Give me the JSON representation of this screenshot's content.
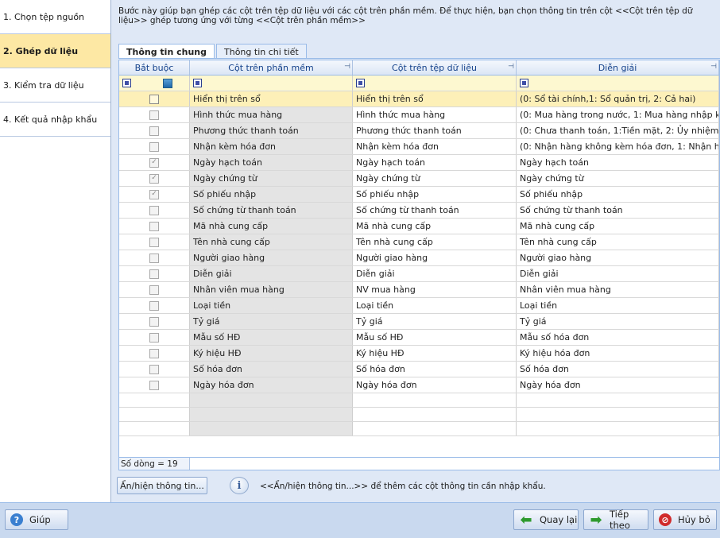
{
  "steps": [
    {
      "label": "1. Chọn tệp nguồn",
      "active": false
    },
    {
      "label": "2. Ghép dữ liệu",
      "active": true
    },
    {
      "label": "3. Kiểm tra dữ liệu",
      "active": false
    },
    {
      "label": "4. Kết quả nhập khẩu",
      "active": false
    }
  ],
  "description": "Bước này giúp bạn ghép các cột trên tệp dữ liệu với các cột trên phần mềm. Để thực hiện, bạn chọn thông tin trên cột <<Cột trên tệp dữ liệu>> ghép tương ứng với từng <<Cột trên phần mềm>>",
  "tabs": [
    {
      "label": "Thông tin chung",
      "active": true
    },
    {
      "label": "Thông tin chi tiết",
      "active": false
    }
  ],
  "grid": {
    "columns": [
      "Bắt buộc",
      "Cột trên phần mềm",
      "Cột trên tệp dữ liệu",
      "Diễn giải"
    ],
    "rows": [
      {
        "required": false,
        "software_col": "Hiển thị trên sổ",
        "file_col": "Hiển thị trên sổ",
        "note": "(0: Sổ tài chính,1: Sổ quản trị, 2: Cả hai)",
        "selected": true
      },
      {
        "required": false,
        "software_col": "Hình thức mua hàng",
        "file_col": "Hình thức mua hàng",
        "note": "(0: Mua hàng trong nước, 1: Mua hàng nhập khẩ..."
      },
      {
        "required": false,
        "software_col": "Phương thức thanh toán",
        "file_col": "Phương thức thanh toán",
        "note": "(0: Chưa thanh toán, 1:Tiền mặt, 2: Ủy nhiệm ch..."
      },
      {
        "required": false,
        "software_col": "Nhận kèm hóa đơn",
        "file_col": "Nhận kèm hóa đơn",
        "note": "(0: Nhận hàng không kèm hóa đơn, 1: Nhận hàn..."
      },
      {
        "required": true,
        "software_col": "Ngày hạch toán",
        "file_col": "Ngày hạch toán",
        "note": "Ngày hạch toán"
      },
      {
        "required": true,
        "software_col": "Ngày chứng từ",
        "file_col": "Ngày chứng từ",
        "note": "Ngày chứng từ"
      },
      {
        "required": true,
        "software_col": "Số phiếu nhập",
        "file_col": "Số phiếu nhập",
        "note": "Số phiếu nhập"
      },
      {
        "required": false,
        "software_col": "Số chứng từ thanh toán",
        "file_col": "Số chứng từ thanh toán",
        "note": "Số chứng từ thanh toán"
      },
      {
        "required": false,
        "software_col": "Mã nhà cung cấp",
        "file_col": "Mã nhà cung cấp",
        "note": "Mã nhà cung cấp"
      },
      {
        "required": false,
        "software_col": "Tên nhà cung cấp",
        "file_col": "Tên nhà cung cấp",
        "note": "Tên nhà cung cấp"
      },
      {
        "required": false,
        "software_col": "Người giao hàng",
        "file_col": "Người giao hàng",
        "note": "Người giao hàng"
      },
      {
        "required": false,
        "software_col": "Diễn giải",
        "file_col": "Diễn giải",
        "note": "Diễn giải"
      },
      {
        "required": false,
        "software_col": "Nhân viên mua hàng",
        "file_col": "NV mua hàng",
        "note": "Nhân viên mua hàng"
      },
      {
        "required": false,
        "software_col": "Loại tiền",
        "file_col": "Loại tiền",
        "note": "Loại tiền"
      },
      {
        "required": false,
        "software_col": "Tỷ giá",
        "file_col": "Tỷ giá",
        "note": "Tỷ giá"
      },
      {
        "required": false,
        "software_col": "Mẫu số HĐ",
        "file_col": "Mẫu số HĐ",
        "note": "Mẫu số hóa đơn"
      },
      {
        "required": false,
        "software_col": "Ký hiệu HĐ",
        "file_col": "Ký hiệu HĐ",
        "note": "Ký hiệu hóa đơn"
      },
      {
        "required": false,
        "software_col": "Số hóa đơn",
        "file_col": "Số hóa đơn",
        "note": "Số hóa đơn"
      },
      {
        "required": false,
        "software_col": "Ngày hóa đơn",
        "file_col": "Ngày hóa đơn",
        "note": "Ngày hóa đơn"
      }
    ],
    "row_count_label": "Số dòng = 19"
  },
  "toggle_button": "Ẩn/hiện thông tin...",
  "info_text": "<<Ẩn/hiện thông tin...>> để thêm các cột thông tin cần nhập khẩu.",
  "buttons": {
    "help": "Giúp",
    "back": "Quay lại",
    "next": "Tiếp theo",
    "cancel": "Hủy bỏ"
  }
}
